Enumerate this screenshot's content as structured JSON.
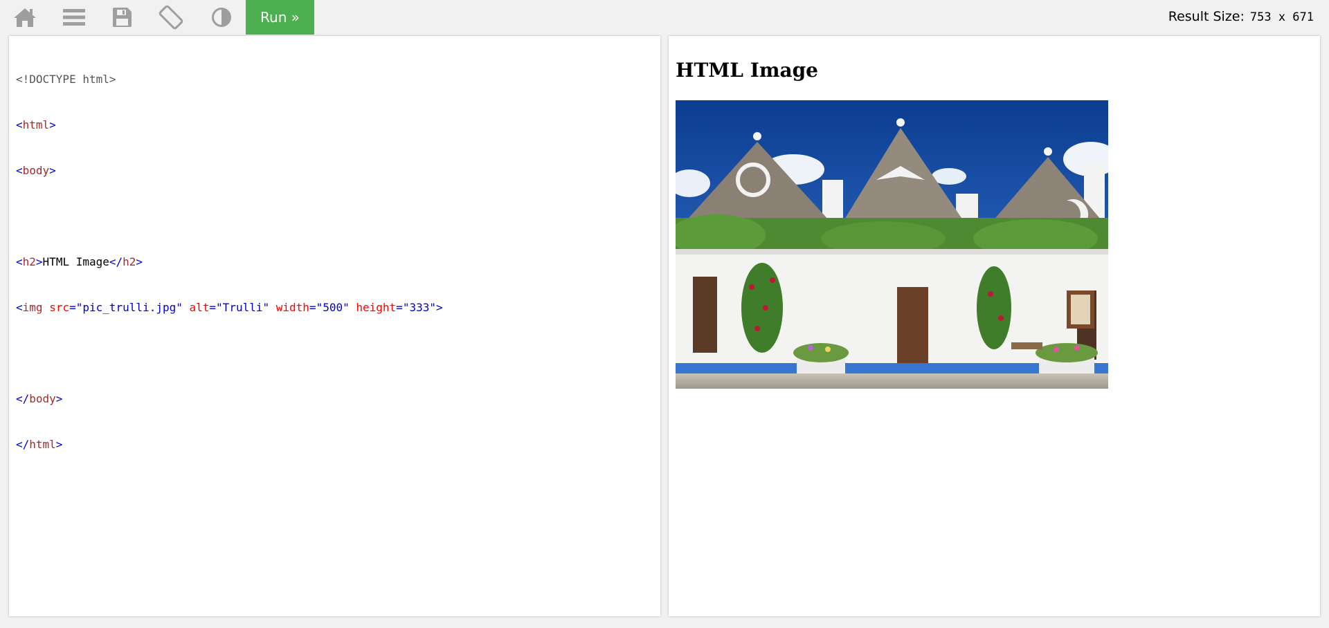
{
  "toolbar": {
    "icons": [
      "home-icon",
      "menu-icon",
      "save-icon",
      "rotate-icon",
      "contrast-icon"
    ],
    "run_label": "Run »",
    "result_size_label": "Result Size:",
    "result_size_value": "753 x 671",
    "accent_color": "#4caf50"
  },
  "code": {
    "doctype": "<!DOCTYPE html>",
    "html_tag": "html",
    "body_tag": "body",
    "h2_tag": "h2",
    "h2_text": "HTML Image",
    "img_tag": "img",
    "img_attrs": [
      {
        "name": "src",
        "value": "\"pic_trulli.jpg\""
      },
      {
        "name": "alt",
        "value": "\"Trulli\""
      },
      {
        "name": "width",
        "value": "\"500\""
      },
      {
        "name": "height",
        "value": "\"333\""
      }
    ],
    "colors": {
      "tag": "#a52a2a",
      "bracket": "#0000cd",
      "attr": "#ff0000",
      "value": "#0000cd"
    }
  },
  "result": {
    "heading": "HTML Image",
    "image_alt": "Trulli"
  }
}
